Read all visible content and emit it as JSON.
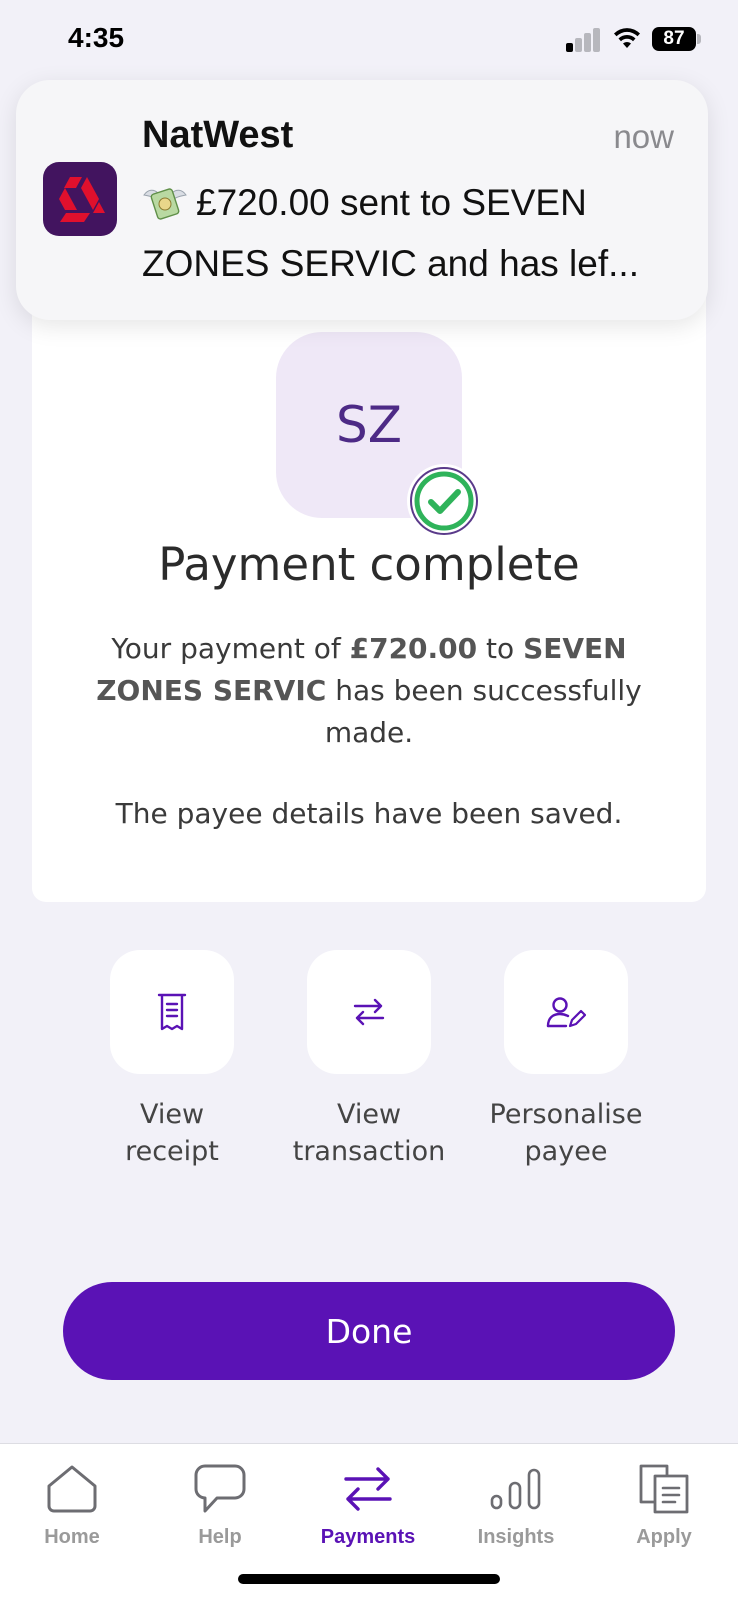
{
  "status_bar": {
    "time": "4:35",
    "battery": "87"
  },
  "notification": {
    "app_name": "NatWest",
    "time": "now",
    "body": "£720.00 sent to SEVEN ZONES SERVIC and has lef...",
    "emoji_icon": "money-with-wings-icon"
  },
  "payee": {
    "initials": "SZ"
  },
  "confirmation": {
    "title": "Payment complete",
    "message_prefix": "Your payment of ",
    "amount": "£720.00",
    "message_mid": " to ",
    "payee_name": "SEVEN ZONES SERVIC",
    "message_suffix": " has been successfully made.",
    "saved_note": "The payee details have been saved."
  },
  "actions": [
    {
      "label_line1": "View",
      "label_line2": "receipt",
      "icon": "receipt-icon"
    },
    {
      "label_line1": "View",
      "label_line2": "transaction",
      "icon": "transfer-arrows-icon"
    },
    {
      "label_line1": "Personalise",
      "label_line2": "payee",
      "icon": "person-edit-icon"
    }
  ],
  "done_label": "Done",
  "tabs": [
    {
      "label": "Home",
      "icon": "home-icon",
      "active": false
    },
    {
      "label": "Help",
      "icon": "chat-bubble-icon",
      "active": false
    },
    {
      "label": "Payments",
      "icon": "transfer-arrows-icon",
      "active": true
    },
    {
      "label": "Insights",
      "icon": "bar-chart-icon",
      "active": false
    },
    {
      "label": "Apply",
      "icon": "documents-icon",
      "active": false
    }
  ],
  "colors": {
    "accent": "#5a12b5",
    "background": "#f2f1f8",
    "success": "#2fb35a",
    "brand_icon_bg": "#42145f",
    "brand_red": "#e0102d"
  }
}
